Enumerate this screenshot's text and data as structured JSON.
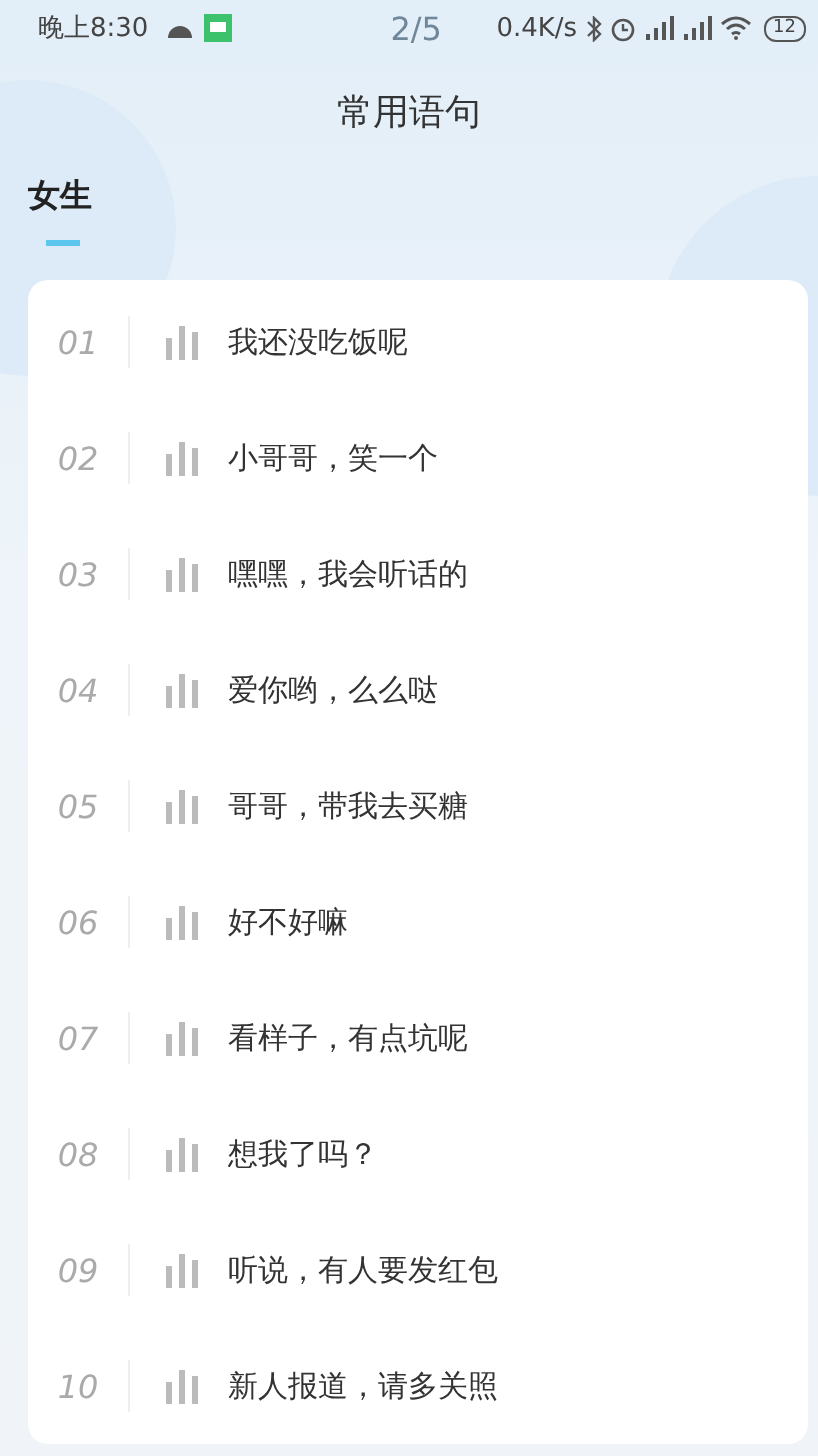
{
  "status_bar": {
    "time": "晚上8:30",
    "page_indicator": "2/5",
    "net_speed": "0.4K/s",
    "battery": "12"
  },
  "title": "常用语句",
  "tabs": [
    {
      "label": "女生",
      "selected": true
    }
  ],
  "phrases": [
    {
      "index": "01",
      "text": "我还没吃饭呢"
    },
    {
      "index": "02",
      "text": "小哥哥，笑一个"
    },
    {
      "index": "03",
      "text": "嘿嘿，我会听话的"
    },
    {
      "index": "04",
      "text": "爱你哟，么么哒"
    },
    {
      "index": "05",
      "text": "哥哥，带我去买糖"
    },
    {
      "index": "06",
      "text": "好不好嘛"
    },
    {
      "index": "07",
      "text": "看样子，有点坑呢"
    },
    {
      "index": "08",
      "text": "想我了吗？"
    },
    {
      "index": "09",
      "text": "听说，有人要发红包"
    },
    {
      "index": "10",
      "text": "新人报道，请多关照"
    }
  ]
}
